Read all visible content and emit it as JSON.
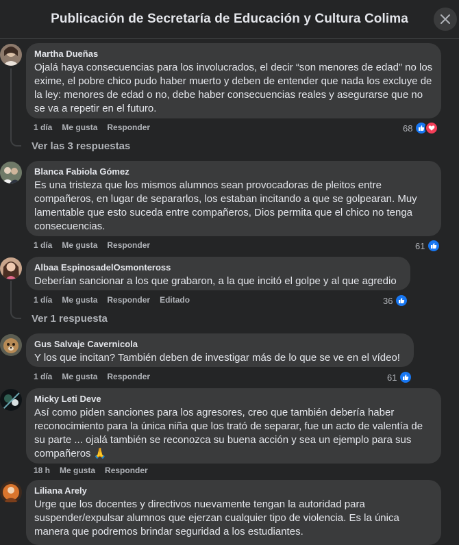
{
  "header": {
    "title": "Publicación de Secretaría de Educación y Cultura Colima"
  },
  "actions": {
    "like": "Me gusta",
    "reply": "Responder"
  },
  "comments": [
    {
      "author": "Martha Dueñas",
      "text": "Ojalá haya consecuencias para los involucrados, el decir “son menores de edad” no los exime, el pobre chico pudo haber muerto y deben de entender que nada los excluye de la ley: menores de edad o no, debe haber consecuencias reales y asegurarse que no se va a repetir en el futuro.",
      "time": "1 día",
      "reactions": "68",
      "reaction_icons": [
        "like-icon",
        "love-icon"
      ],
      "replies": "Ver las 3 respuestas"
    },
    {
      "author": "Blanca Fabiola Gómez",
      "text": "Es una tristeza que los mismos alumnos sean provocadoras de pleitos entre compañeros, en lugar de separarlos, los estaban incitando a que se golpearan. Muy lamentable que esto suceda entre compañeros, Dios permita que el chico no tenga consecuencias.",
      "time": "1 día",
      "reactions": "61",
      "reaction_icons": [
        "like-icon"
      ]
    },
    {
      "author": "Albaa EspinosadelOsmonteross",
      "text": "Deberían sancionar a los que grabaron, a la que incitó el golpe y al que agredio",
      "time": "1 día",
      "edited": "Editado",
      "reactions": "36",
      "reaction_icons": [
        "like-icon"
      ],
      "replies": "Ver 1 respuesta"
    },
    {
      "author": "Gus Salvaje Cavernicola",
      "text": "Y los que incitan? También deben de investigar más de lo que se ve en el vídeo!",
      "time": "1 día",
      "reactions": "61",
      "reaction_icons": [
        "like-icon"
      ]
    },
    {
      "author": "Micky Leti Deve",
      "text": "Así como piden sanciones para los agresores, creo que también debería haber reconocimiento para la única niña que los trató de separar, fue un acto de valentía de su parte ... ojalá también se reconozca su buena acción y sea un ejemplo para sus compañeros 🙏",
      "time": "18 h"
    },
    {
      "author": "Liliana Arely",
      "text": "Urge que los docentes y directivos nuevamente tengan la autoridad para suspender/expulsar alumnos que ejerzan cualquier tipo de violencia. Es la única manera que podremos brindar seguridad a los estudiantes."
    }
  ]
}
